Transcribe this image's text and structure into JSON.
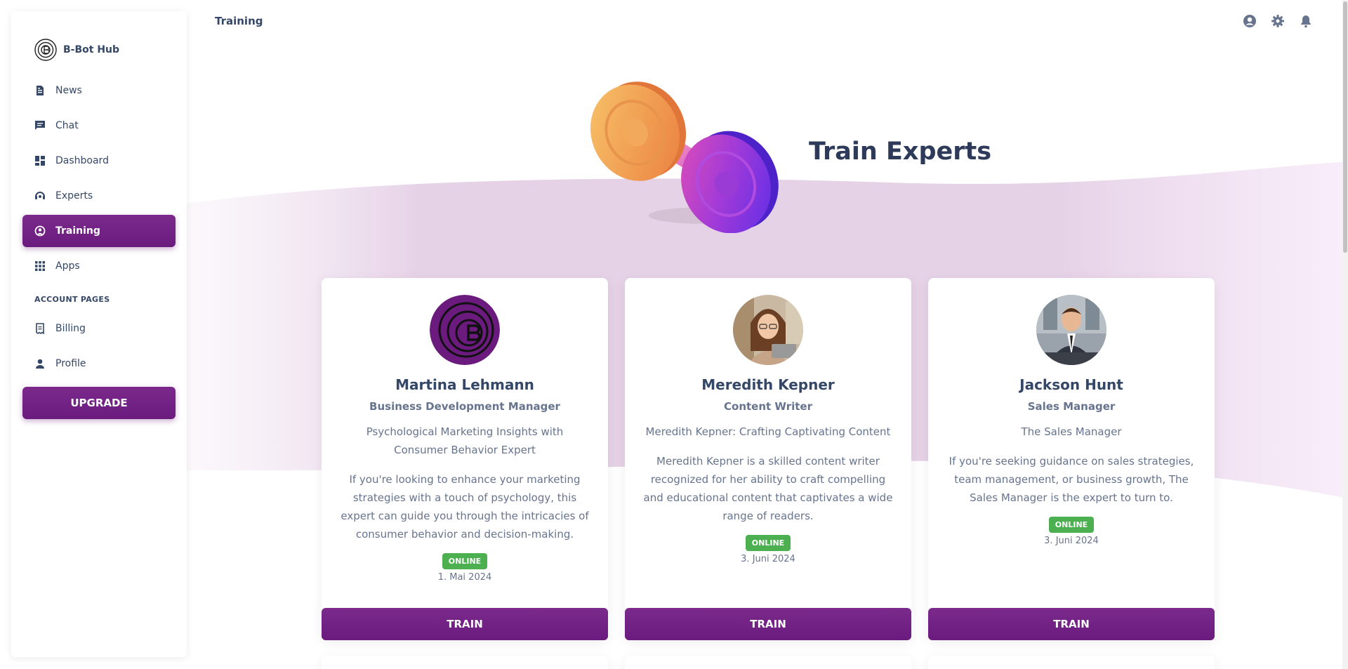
{
  "app": {
    "brand_name": "B-Bot Hub"
  },
  "sidebar": {
    "items": [
      {
        "label": "News",
        "icon": "news-icon"
      },
      {
        "label": "Chat",
        "icon": "chat-icon"
      },
      {
        "label": "Dashboard",
        "icon": "dashboard-icon"
      },
      {
        "label": "Experts",
        "icon": "experts-icon"
      },
      {
        "label": "Training",
        "icon": "training-icon",
        "active": true
      },
      {
        "label": "Apps",
        "icon": "apps-grid-icon"
      }
    ],
    "section_title": "ACCOUNT PAGES",
    "account_items": [
      {
        "label": "Billing",
        "icon": "billing-icon"
      },
      {
        "label": "Profile",
        "icon": "profile-icon"
      }
    ],
    "upgrade_label": "UPGRADE"
  },
  "topbar": {
    "title": "Training",
    "icons": [
      "account-circle-icon",
      "settings-gear-icon",
      "notification-bell-icon"
    ]
  },
  "hero": {
    "title": "Train Experts"
  },
  "cards": [
    {
      "name": "Martina Lehmann",
      "role": "Business Development Manager",
      "subtitle": "Psychological Marketing Insights with Consumer Behavior Expert",
      "description": "If you're looking to enhance your marketing strategies with a touch of psychology, this expert can guide you through the intricacies of consumer behavior and decision-making.",
      "status": "ONLINE",
      "date": "1. Mai 2024",
      "button": "TRAIN"
    },
    {
      "name": "Meredith Kepner",
      "role": "Content Writer",
      "subtitle": "Meredith Kepner: Crafting Captivating Content",
      "description": "Meredith Kepner is a skilled content writer recognized for her ability to craft compelling and educational content that captivates a wide range of readers.",
      "status": "ONLINE",
      "date": "3. Juni 2024",
      "button": "TRAIN"
    },
    {
      "name": "Jackson Hunt",
      "role": "Sales Manager",
      "subtitle": "The Sales Manager",
      "description": "If you're seeking guidance on sales strategies, team management, or business growth, The Sales Manager is the expert to turn to.",
      "status": "ONLINE",
      "date": "3. Juni 2024",
      "button": "TRAIN"
    }
  ],
  "colors": {
    "primary": "#6f1f80",
    "text_dark": "#344767",
    "text_muted": "#67748e",
    "online_badge": "#4caf50"
  }
}
